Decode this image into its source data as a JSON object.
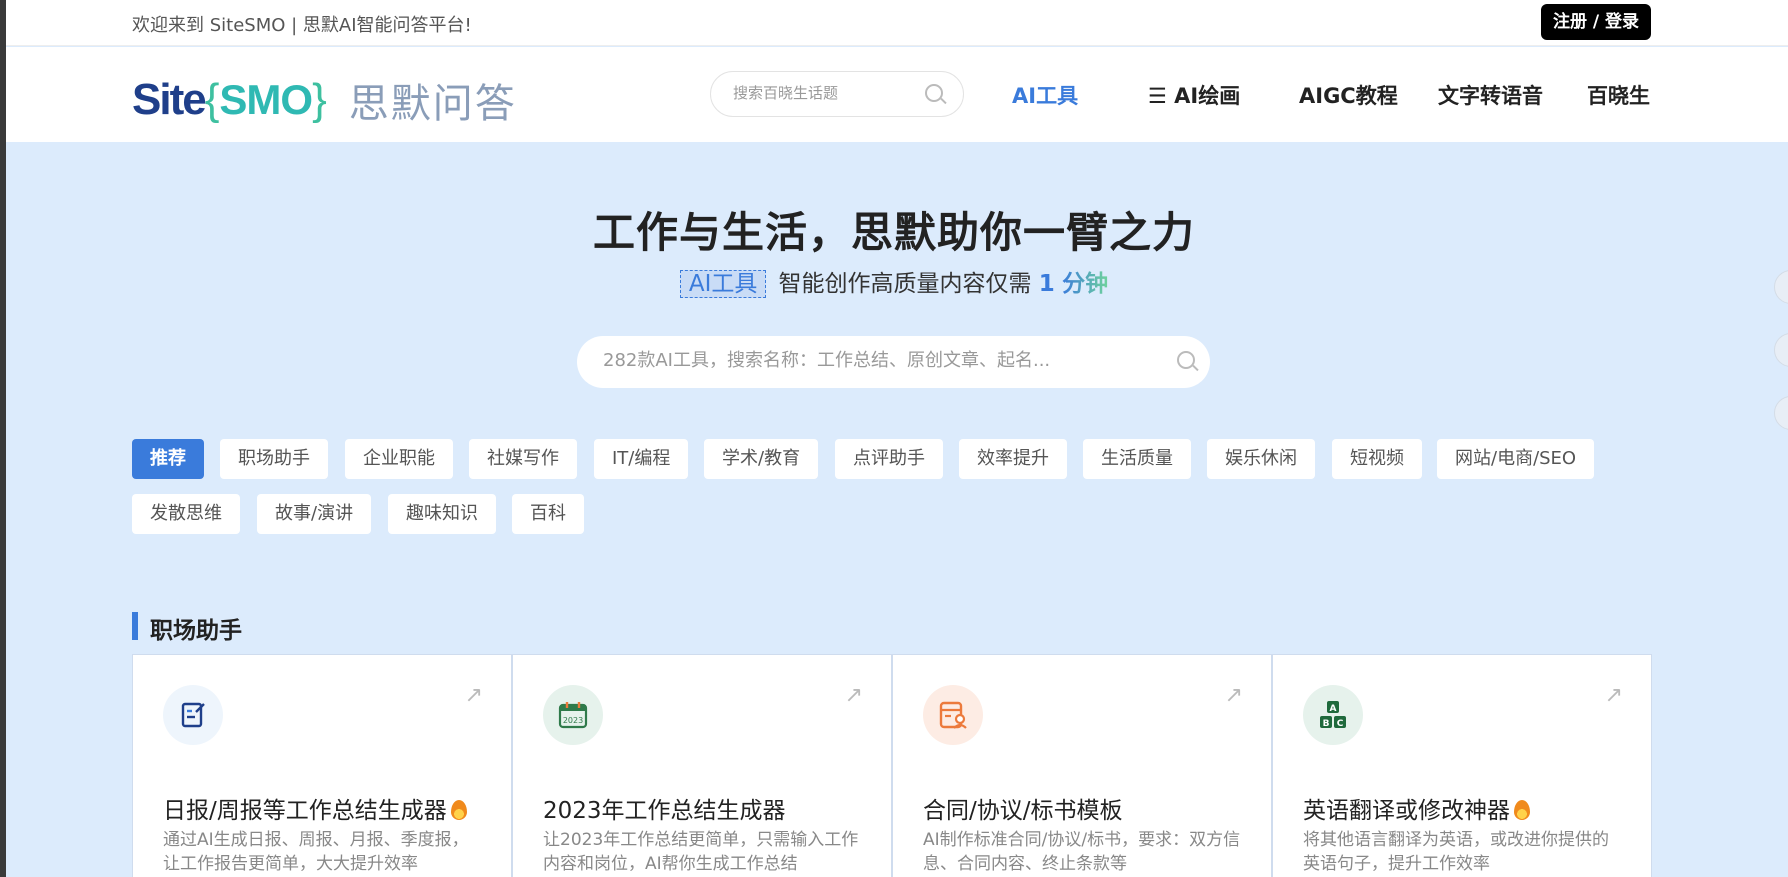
{
  "topbar": {
    "welcome": "欢迎来到 SiteSMO | 思默AI智能问答平台!",
    "login": "注册 / 登录"
  },
  "logo": {
    "site": "Site",
    "smo": "SMO",
    "cn": "思默问答"
  },
  "header_search": {
    "placeholder": "搜索百晓生话题"
  },
  "nav": [
    {
      "label": "AI工具"
    },
    {
      "label": "☰ AI绘画"
    },
    {
      "label": "AIGC教程"
    },
    {
      "label": "文字转语音"
    },
    {
      "label": "百晓生"
    }
  ],
  "hero": {
    "title": "工作与生活，思默助你一臂之力",
    "tag": "AI工具",
    "sub_text": "智能创作高质量内容仅需",
    "num": "1",
    "unit": "分钟"
  },
  "main_search": {
    "placeholder": "282款AI工具，搜索名称：工作总结、原创文章、起名..."
  },
  "categories": [
    "推荐",
    "职场助手",
    "企业职能",
    "社媒写作",
    "IT/编程",
    "学术/教育",
    "点评助手",
    "效率提升",
    "生活质量",
    "娱乐休闲",
    "短视频",
    "网站/电商/SEO",
    "发散思维",
    "故事/演讲",
    "趣味知识",
    "百科"
  ],
  "section": {
    "title": "职场助手"
  },
  "cards": [
    {
      "title": "日报/周报等工作总结生成器",
      "hot": true,
      "desc": "通过AI生成日报、周报、月报、季度报，让工作报告更简单，大大提升效率",
      "icon": "edit-icon",
      "icon_bg": "#eef5fc",
      "icon_color": "#1f3f8a"
    },
    {
      "title": "2023年工作总结生成器",
      "hot": false,
      "desc": "让2023年工作总结更简单，只需输入工作内容和岗位，AI帮你生成工作总结",
      "icon": "calendar-icon",
      "icon_bg": "#e6f2ec",
      "icon_color": "#2f7a4a"
    },
    {
      "title": "合同/协议/标书模板",
      "hot": false,
      "desc": "AI制作标准合同/协议/标书，要求：双方信息、合同内容、终止条款等",
      "icon": "contract-icon",
      "icon_bg": "#fdece4",
      "icon_color": "#ec7a3c"
    },
    {
      "title": "英语翻译或修改神器",
      "hot": true,
      "desc": "将其他语言翻译为英语，或改进你提供的英语句子，提升工作效率",
      "icon": "abc-blocks-icon",
      "icon_bg": "#e6f2ec",
      "icon_color": "#1f6a3c"
    }
  ]
}
